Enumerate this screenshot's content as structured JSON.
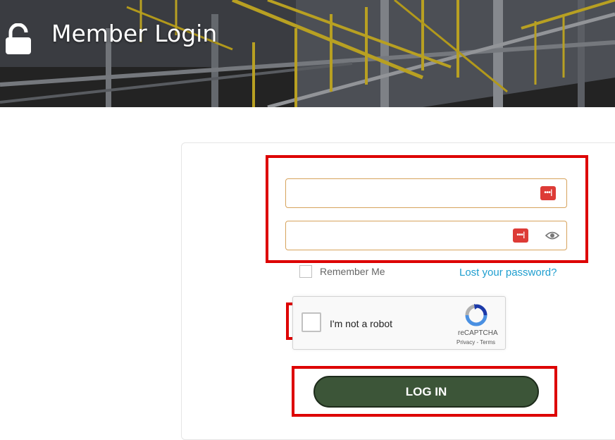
{
  "header": {
    "title": "Member Login",
    "icon": "lock-icon"
  },
  "form": {
    "username": {
      "value": "",
      "placeholder": "",
      "icon": "password-manager-icon"
    },
    "password": {
      "value": "",
      "placeholder": "",
      "icon": "password-manager-icon",
      "reveal_icon": "eye-icon"
    },
    "password_manager_glyph": "•••|",
    "remember_label": "Remember Me",
    "lost_password_label": "Lost your password?",
    "captcha": {
      "label": "I'm not a robot",
      "brand": "reCAPTCHA",
      "privacy": "Privacy",
      "separator": " - ",
      "terms": "Terms"
    },
    "login_label": "LOG IN"
  },
  "colors": {
    "accent_link": "#1e9ecf",
    "button_bg": "#3c5538",
    "field_border": "#d7a35c",
    "highlight": "#dd0000",
    "password_manager": "#dd3b36"
  }
}
